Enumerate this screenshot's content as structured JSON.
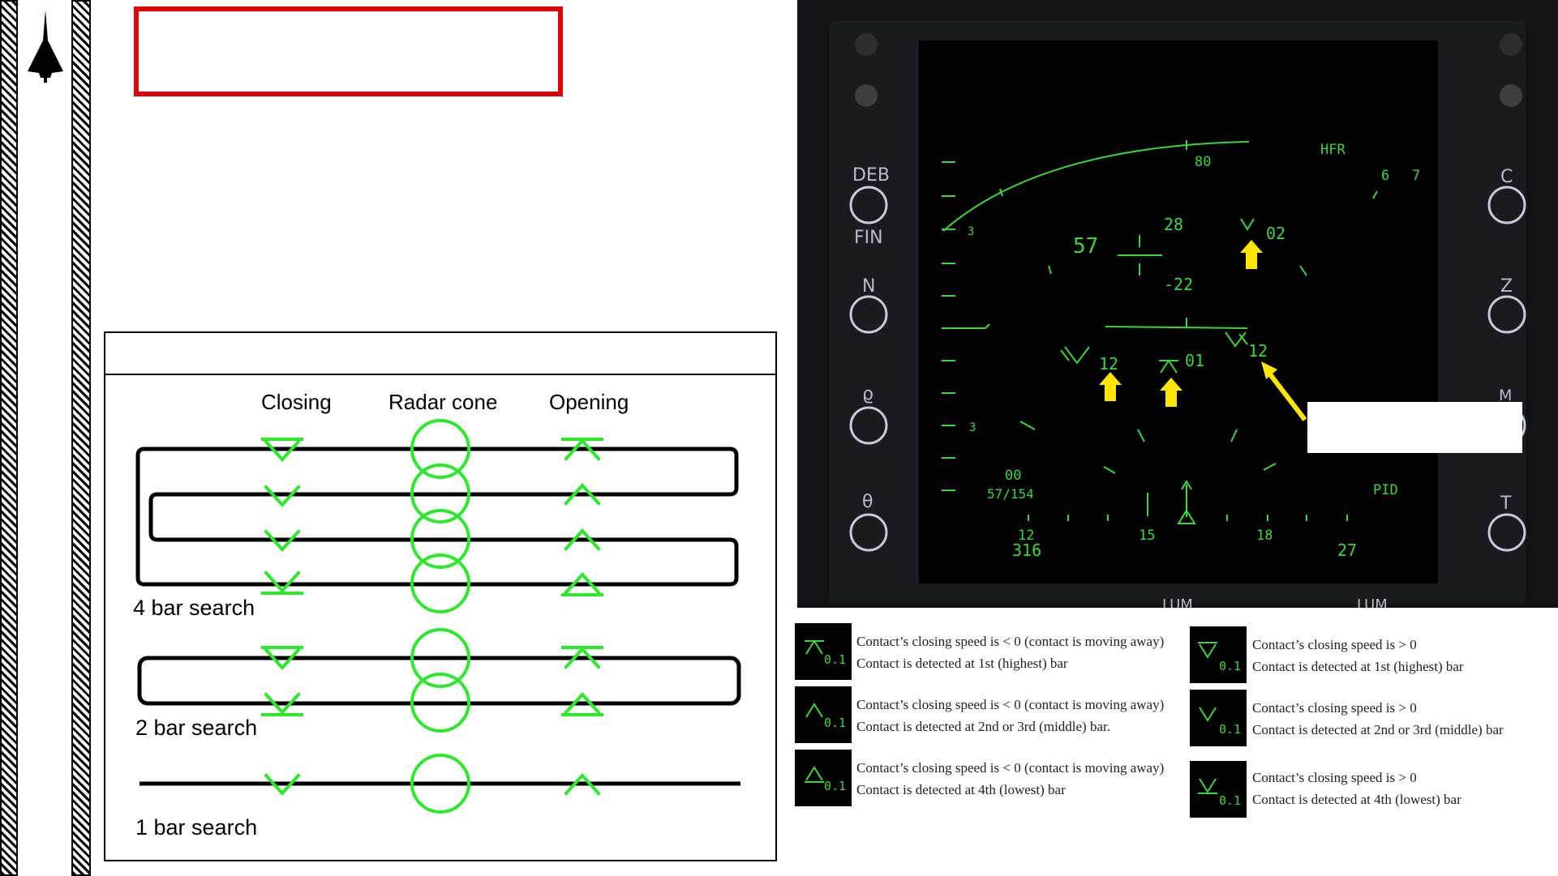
{
  "diagram": {
    "column_headers": {
      "closing": "Closing",
      "radar_cone": "Radar cone",
      "opening": "Opening"
    },
    "search_labels": {
      "bar4": "4 bar search",
      "bar2": "2 bar search",
      "bar1": "1 bar search"
    }
  },
  "mfd": {
    "side_buttons_left": [
      "DEB",
      "FIN",
      "N",
      "ϱ",
      "θ"
    ],
    "side_buttons_right": [
      "C",
      "Z",
      "M",
      "T"
    ],
    "bottom_labels": [
      "LUM",
      "LUM"
    ],
    "display": {
      "mode": "HFR",
      "range_top": "80",
      "corner_numbers": [
        "6",
        "7"
      ],
      "altitude_marks": [
        "3",
        "3"
      ],
      "cursor_left": "57",
      "cursor_top": "28",
      "cursor_bottom": "-22",
      "contacts": [
        {
          "label": "02",
          "type": "closing"
        },
        {
          "label": "12",
          "type": "closing"
        },
        {
          "label": "01",
          "type": "opening"
        },
        {
          "label": "12",
          "type": "closing"
        }
      ],
      "lower_left_top": "00",
      "lower_left_bottom": "57/154",
      "heading_scale": [
        "12",
        "15",
        "18"
      ],
      "heading_value": "316",
      "range_value": "27",
      "pid": "PID"
    }
  },
  "legend": {
    "left": [
      {
        "icon_label": "0.1",
        "line1": "Contact’s closing speed is < 0 (contact is moving away)",
        "line2": "Contact is detected at 1st (highest) bar"
      },
      {
        "icon_label": "0.1",
        "line1": "Contact’s closing speed is < 0 (contact is moving away)",
        "line2": "Contact is detected at 2nd or 3rd (middle) bar."
      },
      {
        "icon_label": "0.1",
        "line1": "Contact’s closing speed is < 0 (contact is moving away)",
        "line2": "Contact is detected at 4th (lowest) bar"
      }
    ],
    "right": [
      {
        "icon_label": "0.1",
        "line1": "Contact’s closing speed is > 0",
        "line2": "Contact is detected at 1st (highest) bar"
      },
      {
        "icon_label": "0.1",
        "line1": "Contact’s closing speed is > 0",
        "line2": "Contact is detected at 2nd or 3rd (middle) bar"
      },
      {
        "icon_label": "0.1",
        "line1": "Contact’s closing speed is > 0",
        "line2": "Contact is detected at 4th (lowest) bar"
      }
    ]
  },
  "colors": {
    "radar_green": "#2ee82e",
    "mfd_green": "#3fd43f",
    "callout_red": "#e00000",
    "arrow_yellow": "#ffe600"
  }
}
